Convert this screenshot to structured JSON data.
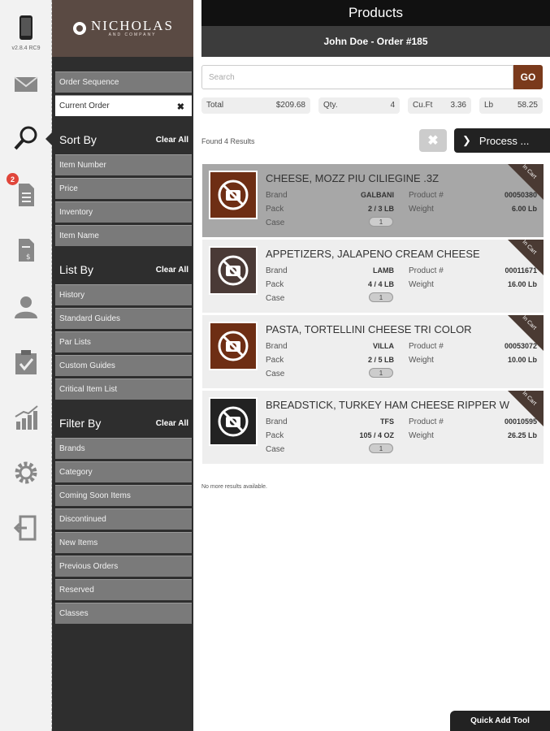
{
  "app": {
    "version": "v2.8.4 RC9",
    "notification_count": "2",
    "brand": {
      "name": "NICHOLAS",
      "subtitle": "AND COMPANY"
    }
  },
  "rail": {
    "icons": [
      "device-icon",
      "mail-icon",
      "search-icon",
      "document-icon",
      "invoice-icon",
      "user-icon",
      "clipboard-check-icon",
      "chart-icon",
      "gear-icon",
      "logout-icon"
    ]
  },
  "menu": {
    "order_sequence": "Order Sequence",
    "current_order": "Current Order",
    "sort_by": {
      "title": "Sort By",
      "clear": "Clear All",
      "items": [
        "Item Number",
        "Price",
        "Inventory",
        "Item Name"
      ]
    },
    "list_by": {
      "title": "List By",
      "clear": "Clear All",
      "items": [
        "History",
        "Standard Guides",
        "Par Lists",
        "Custom Guides",
        "Critical Item List"
      ]
    },
    "filter_by": {
      "title": "Filter By",
      "clear": "Clear All",
      "items": [
        "Brands",
        "Category",
        "Coming Soon Items",
        "Discontinued",
        "New Items",
        "Previous Orders",
        "Reserved",
        "Classes"
      ]
    }
  },
  "header": {
    "title": "Products",
    "order": "John Doe - Order #185"
  },
  "search": {
    "placeholder": "Search",
    "go": "GO"
  },
  "stats": {
    "total_label": "Total",
    "total": "$209.68",
    "qty_label": "Qty.",
    "qty": "4",
    "cuft_label": "Cu.Ft",
    "cuft": "3.36",
    "lb_label": "Lb",
    "lb": "58.25"
  },
  "results": {
    "found": "Found 4 Results",
    "clear": "✖",
    "process": "Process ...",
    "no_more": "No more results available."
  },
  "labels": {
    "brand": "Brand",
    "pack": "Pack",
    "case": "Case",
    "product": "Product #",
    "weight": "Weight",
    "in_cart": "In Cart"
  },
  "colors": {
    "brand_brown": "#7a3a1c",
    "logo_bg": "#5a4a43"
  },
  "products": [
    {
      "name": "CHEESE, MOZZ PIU CILIEGINE .3Z",
      "brand": "GALBANI",
      "pack": "2 / 3 LB",
      "product_no": "00050380",
      "weight": "6.00 Lb",
      "case_qty": "1",
      "thumb_color": "#6e2e14"
    },
    {
      "name": "APPETIZERS, JALAPENO CREAM CHEESE",
      "brand": "LAMB",
      "pack": "4 / 4 LB",
      "product_no": "00011671",
      "weight": "16.00 Lb",
      "case_qty": "1",
      "thumb_color": "#4a3a36"
    },
    {
      "name": "PASTA, TORTELLINI CHEESE TRI COLOR",
      "brand": "VILLA",
      "pack": "2 / 5 LB",
      "product_no": "00053072",
      "weight": "10.00 Lb",
      "case_qty": "1",
      "thumb_color": "#6e2e14"
    },
    {
      "name": "BREADSTICK, TURKEY HAM CHEESE RIPPER W",
      "brand": "TFS",
      "pack": "105 / 4 OZ",
      "product_no": "00010595",
      "weight": "26.25 Lb",
      "case_qty": "1",
      "thumb_color": "#222222"
    }
  ],
  "quick_add": "Quick Add Tool"
}
